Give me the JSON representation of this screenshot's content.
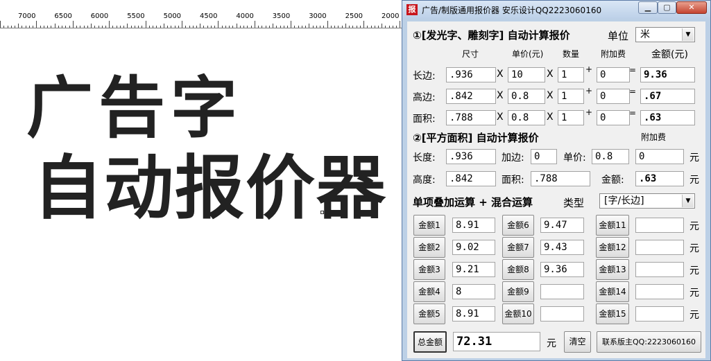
{
  "ruler": {
    "ticks": [
      "7000",
      "6500",
      "6000",
      "5500",
      "5000",
      "4500",
      "4000",
      "3500",
      "3000",
      "2500",
      "2000"
    ]
  },
  "canvas": {
    "line1": "广告字",
    "line2": "自动报价器"
  },
  "window": {
    "title": "广告/制版通用报价器  安乐设计QQ2223060160",
    "icon": "报"
  },
  "section1": {
    "title": "①[发光字、雕刻字] 自动计算报价",
    "unit_label": "单位",
    "unit_value": "米",
    "headers": {
      "size": "尺寸",
      "price": "单价(元)",
      "qty": "数量",
      "fee": "附加费",
      "amount": "金额(元)"
    },
    "rows": [
      {
        "label": "长边:",
        "size": ".936",
        "price": "10",
        "qty": "1",
        "fee": "0",
        "amount": "9.36"
      },
      {
        "label": "高边:",
        "size": ".842",
        "price": "0.8",
        "qty": "1",
        "fee": "0",
        "amount": ".67"
      },
      {
        "label": "面积:",
        "size": ".788",
        "price": "0.8",
        "qty": "1",
        "fee": "0",
        "amount": ".63"
      }
    ],
    "x": "X",
    "plus": "+",
    "eq": "="
  },
  "section2": {
    "title": "②[平方面积] 自动计算报价",
    "fee_header": "附加费",
    "length_label": "长度:",
    "length": ".936",
    "side_label": "加边:",
    "side": "0",
    "unitprice_label": "单价:",
    "unitprice": "0.8",
    "fee": "0",
    "yuan": "元",
    "height_label": "高度:",
    "height": ".842",
    "area_label": "面积:",
    "area": ".788",
    "amount_label": "金额:",
    "amount": ".63"
  },
  "section3": {
    "title": "单项叠加运算 + 混合运算",
    "type_label": "类型",
    "type_value": "[字/长边]",
    "col1": [
      {
        "label": "金额1",
        "value": "8.91"
      },
      {
        "label": "金额2",
        "value": "9.02"
      },
      {
        "label": "金额3",
        "value": "9.21"
      },
      {
        "label": "金额4",
        "value": "8"
      },
      {
        "label": "金额5",
        "value": "8.91"
      }
    ],
    "col2": [
      {
        "label": "金额6",
        "value": "9.47"
      },
      {
        "label": "金额7",
        "value": "9.43"
      },
      {
        "label": "金额8",
        "value": "9.36"
      },
      {
        "label": "金额9",
        "value": ""
      },
      {
        "label": "金额10",
        "value": ""
      }
    ],
    "col3": [
      {
        "label": "金额11",
        "value": ""
      },
      {
        "label": "金额12",
        "value": ""
      },
      {
        "label": "金额13",
        "value": ""
      },
      {
        "label": "金额14",
        "value": ""
      },
      {
        "label": "金额15",
        "value": ""
      }
    ],
    "yuan": "元"
  },
  "footer": {
    "total_button": "总金额",
    "total": "72.31",
    "yuan": "元",
    "clear_button": "清空",
    "contact_button": "联系版主QQ:2223060160"
  }
}
